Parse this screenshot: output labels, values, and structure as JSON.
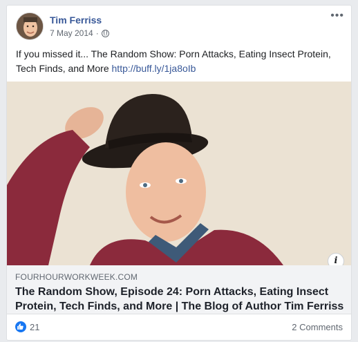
{
  "post": {
    "author": "Tim Ferriss",
    "date": "7 May 2014",
    "separator": "·",
    "privacy_icon": "globe-icon",
    "more_icon": "more-dots-icon",
    "more_label": "•••",
    "text": "If you missed it... The Random Show: Porn Attacks, Eating Insect Protein, Tech Finds, and More",
    "link_text": "http://buff.ly/1ja8oIb"
  },
  "link_preview": {
    "domain": "FOURHOURWORKWEEK.COM",
    "title": "The Random Show, Episode 24: Porn Attacks, Eating Insect Protein, Tech Finds, and More | The Blog of Author Tim Ferriss",
    "info_label": "i"
  },
  "footer": {
    "like_icon": "thumbs-up-icon",
    "like_count": "21",
    "comments_label": "2 Comments"
  },
  "colors": {
    "link_blue": "#385898",
    "like_blue": "#1877f2",
    "muted": "#606770"
  }
}
